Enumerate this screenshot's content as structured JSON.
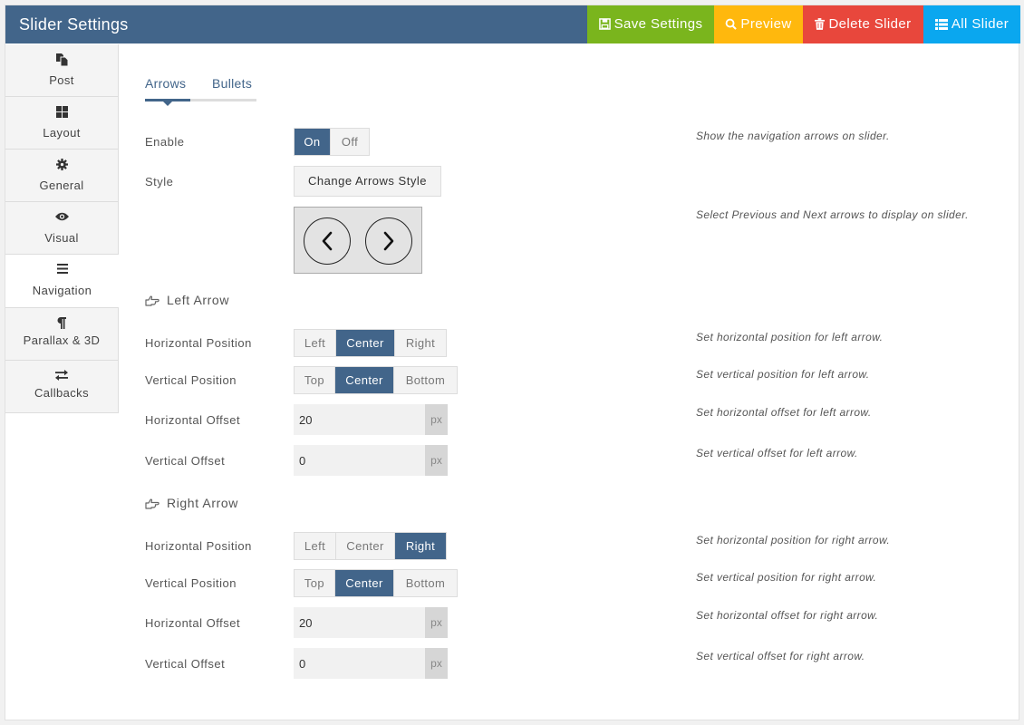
{
  "header": {
    "title": "Slider Settings",
    "buttons": {
      "save": "Save Settings",
      "preview": "Preview",
      "delete": "Delete Slider",
      "all": "All Slider"
    }
  },
  "sidebar": {
    "items": [
      {
        "label": "Post",
        "icon": "copy-icon"
      },
      {
        "label": "Layout",
        "icon": "grid-icon"
      },
      {
        "label": "General",
        "icon": "gear-icon"
      },
      {
        "label": "Visual",
        "icon": "eye-icon"
      },
      {
        "label": "Navigation",
        "icon": "bars-icon",
        "active": true
      },
      {
        "label": "Parallax & 3D",
        "icon": "paragraph-icon"
      },
      {
        "label": "Callbacks",
        "icon": "exchange-icon"
      }
    ]
  },
  "tabs": {
    "arrows": "Arrows",
    "bullets": "Bullets",
    "active": "Arrows"
  },
  "arrows": {
    "enable": {
      "label": "Enable",
      "on": "On",
      "off": "Off",
      "value": "On",
      "desc": "Show the navigation arrows on slider."
    },
    "style": {
      "label": "Style",
      "button": "Change Arrows Style",
      "desc": "Select Previous and Next arrows to display on slider."
    },
    "left": {
      "heading": "Left Arrow",
      "hpos": {
        "label": "Horizontal Position",
        "options": [
          "Left",
          "Center",
          "Right"
        ],
        "value": "Center",
        "desc": "Set horizontal position for left arrow."
      },
      "vpos": {
        "label": "Vertical Position",
        "options": [
          "Top",
          "Center",
          "Bottom"
        ],
        "value": "Center",
        "desc": "Set vertical position for left arrow."
      },
      "hoff": {
        "label": "Horizontal Offset",
        "value": "20",
        "unit": "px",
        "desc": "Set horizontal offset for left arrow."
      },
      "voff": {
        "label": "Vertical Offset",
        "value": "0",
        "unit": "px",
        "desc": "Set vertical offset for left arrow."
      }
    },
    "right": {
      "heading": "Right Arrow",
      "hpos": {
        "label": "Horizontal Position",
        "options": [
          "Left",
          "Center",
          "Right"
        ],
        "value": "Right",
        "desc": "Set horizontal position for right arrow."
      },
      "vpos": {
        "label": "Vertical Position",
        "options": [
          "Top",
          "Center",
          "Bottom"
        ],
        "value": "Center",
        "desc": "Set vertical position for right arrow."
      },
      "hoff": {
        "label": "Horizontal Offset",
        "value": "20",
        "unit": "px",
        "desc": "Set horizontal offset for right arrow."
      },
      "voff": {
        "label": "Vertical Offset",
        "value": "0",
        "unit": "px",
        "desc": "Set vertical offset for right arrow."
      }
    }
  },
  "colors": {
    "primary": "#42658a",
    "save": "#7ab51d",
    "preview": "#ffb80d",
    "delete": "#e8473c",
    "all": "#0aa7ef"
  }
}
